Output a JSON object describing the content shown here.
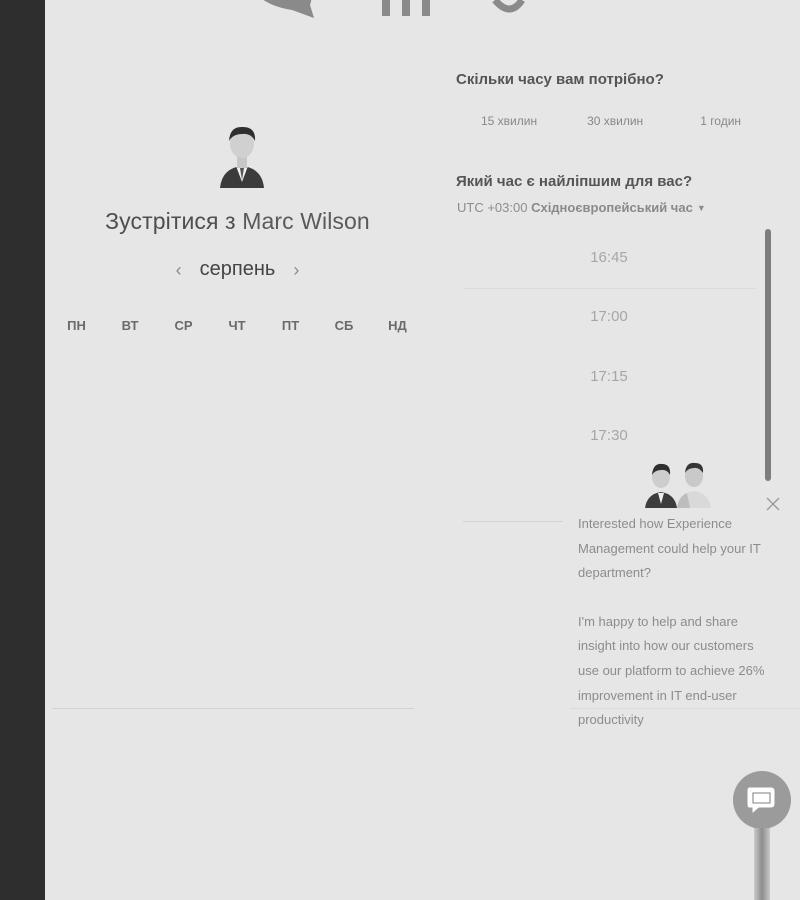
{
  "meeting": {
    "title_prefix": "Зустрітися з",
    "host_name": "Marc Wilson"
  },
  "calendar": {
    "month": "серпень",
    "prev_glyph": "‹",
    "next_glyph": "›",
    "weekdays": [
      "ПН",
      "ВТ",
      "СР",
      "ЧТ",
      "ПТ",
      "СБ",
      "НД"
    ]
  },
  "duration": {
    "question": "Скільки часу вам потрібно?",
    "options": [
      "15 хвилин",
      "30 хвилин",
      "1 годин"
    ]
  },
  "time": {
    "question": "Який час є найліпшим для вас?",
    "timezone_offset": "UTC +03:00",
    "timezone_name": "Східноєвропейський час",
    "slots": [
      "16:45",
      "17:00",
      "17:15",
      "17:30"
    ]
  },
  "chat": {
    "message_1": "Interested how Experience Management could help your IT department?",
    "message_2": "I'm happy to help and share insight into how our customers use our platform to achieve 26% improvement in IT end-user productivity"
  },
  "colors": {
    "left_strip": "#2e2e2e",
    "background": "#e6e6e6",
    "chat_button": "#9b9b9b"
  },
  "icons": {
    "prev_month": "chevron-left-icon",
    "next_month": "chevron-right-icon",
    "timezone_dropdown": "caret-down-icon",
    "chat_close": "close-icon",
    "chat_launcher": "chat-bubble-icon"
  }
}
